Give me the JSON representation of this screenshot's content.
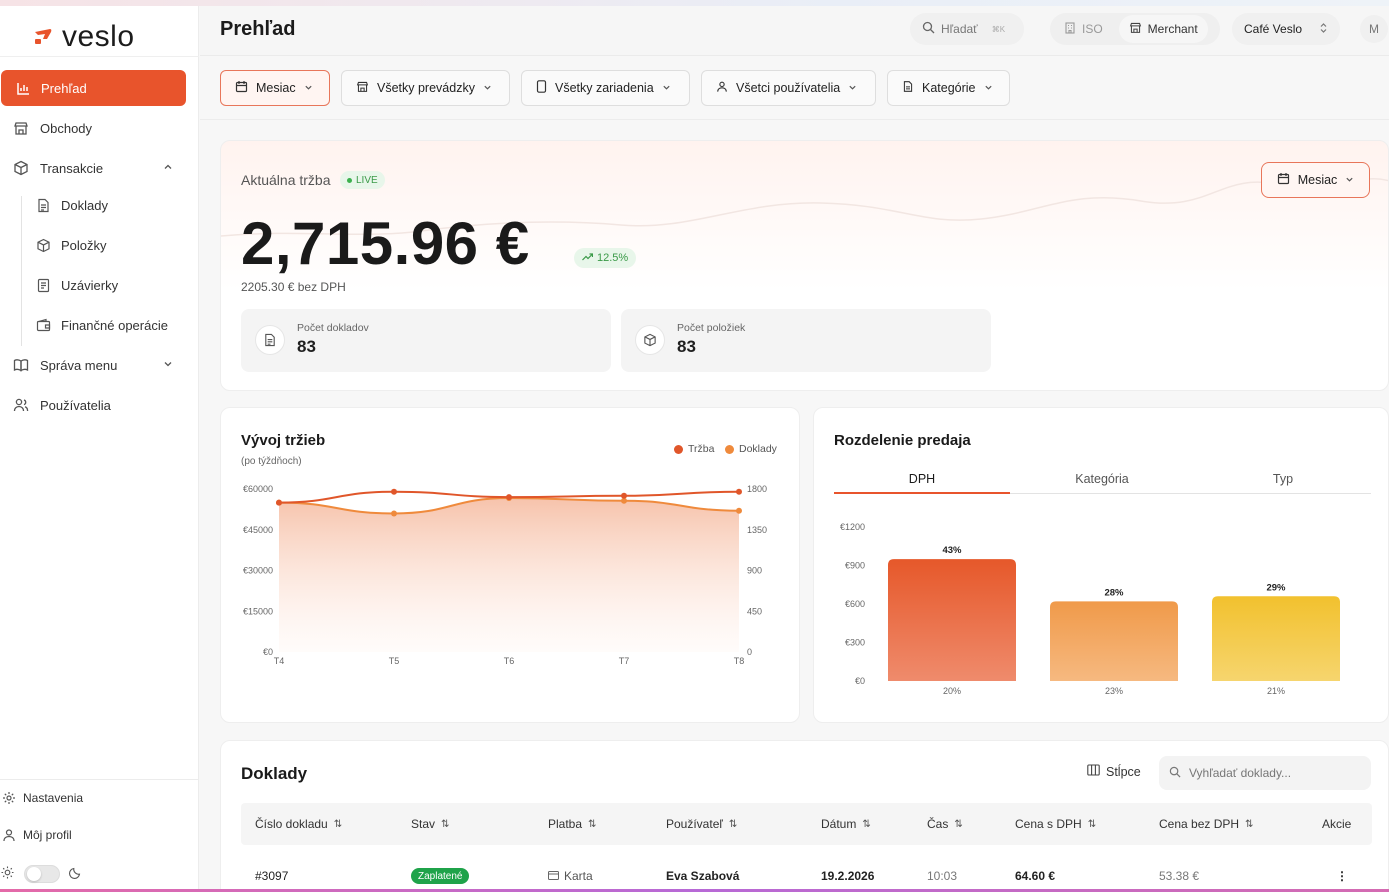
{
  "app": {
    "logo_text": "veslo",
    "brand_color": "#e8542c"
  },
  "sidebar": {
    "items": [
      {
        "label": "Prehľad",
        "icon": "bar-chart-icon",
        "active": true
      },
      {
        "label": "Obchody",
        "icon": "store-icon"
      },
      {
        "label": "Transakcie",
        "icon": "box-icon",
        "expanded": true
      },
      {
        "label": "Doklady",
        "icon": "document-icon",
        "sub": true
      },
      {
        "label": "Položky",
        "icon": "package-icon",
        "sub": true
      },
      {
        "label": "Uzávierky",
        "icon": "receipt-icon",
        "sub": true
      },
      {
        "label": "Finančné operácie",
        "icon": "wallet-icon",
        "sub": true
      },
      {
        "label": "Správa menu",
        "icon": "book-icon"
      },
      {
        "label": "Používatelia",
        "icon": "users-icon"
      }
    ],
    "bottom": {
      "settings": "Nastavenia",
      "profile": "Môj profil"
    }
  },
  "header": {
    "title": "Prehľad",
    "search_label": "Hľadať",
    "search_shortcut": "⌘K",
    "iso_label": "ISO",
    "merchant_label": "Merchant",
    "store_select": "Café Veslo",
    "avatar_initial": "M"
  },
  "filters": [
    {
      "label": "Mesiac",
      "icon": "calendar-icon",
      "active": true
    },
    {
      "label": "Všetky prevádzky",
      "icon": "store-icon"
    },
    {
      "label": "Všetky zariadenia",
      "icon": "device-icon"
    },
    {
      "label": "Všetci používatelia",
      "icon": "user-icon"
    },
    {
      "label": "Kategórie",
      "icon": "file-icon"
    }
  ],
  "revenue": {
    "label": "Aktuálna tržba",
    "live": "LIVE",
    "amount": "2,715.96 €",
    "trend": "12.5%",
    "without_vat": "2205.30 € bez DPH",
    "period_button": "Mesiac",
    "stats": [
      {
        "label": "Počet dokladov",
        "value": "83",
        "icon": "document-icon"
      },
      {
        "label": "Počet položiek",
        "value": "83",
        "icon": "package-icon"
      }
    ]
  },
  "trend_card": {
    "title": "Vývoj tržieb",
    "subtitle": "(po týždňoch)",
    "legend": [
      "Tržba",
      "Doklady"
    ]
  },
  "split_card": {
    "title": "Rozdelenie predaja",
    "tabs": [
      "DPH",
      "Kategória",
      "Typ"
    ],
    "active_tab": 0
  },
  "chart_data": [
    {
      "type": "line",
      "title": "Vývoj tržieb",
      "subtitle": "(po týždňoch)",
      "x": [
        "T4",
        "T5",
        "T6",
        "T7",
        "T8"
      ],
      "series": [
        {
          "name": "Tržba",
          "axis": "left",
          "values": [
            55000,
            59000,
            57000,
            57500,
            59000
          ],
          "color": "#e0562a"
        },
        {
          "name": "Doklady",
          "axis": "right",
          "values": [
            1650,
            1530,
            1700,
            1670,
            1560
          ],
          "color": "#ef8a3c"
        }
      ],
      "y_left": {
        "ticks": [
          "€0",
          "€15000",
          "€30000",
          "€45000",
          "€60000"
        ],
        "range": [
          0,
          60000
        ]
      },
      "y_right": {
        "ticks": [
          "0",
          "450",
          "900",
          "1350",
          "1800"
        ],
        "range": [
          0,
          1800
        ]
      },
      "grid": false,
      "legend_position": "top-right"
    },
    {
      "type": "bar",
      "title": "Rozdelenie predaja",
      "categories": [
        "20%",
        "23%",
        "21%"
      ],
      "values": [
        950,
        620,
        660
      ],
      "data_labels": [
        "43%",
        "28%",
        "29%"
      ],
      "colors": [
        [
          "#e6582a",
          "#ef8b6c"
        ],
        [
          "#f09a4a",
          "#f6b980"
        ],
        [
          "#f2c12e",
          "#f6d56e"
        ]
      ],
      "y_ticks": [
        "€0",
        "€300",
        "€600",
        "€900",
        "€1200"
      ],
      "ylim": [
        0,
        1200
      ]
    }
  ],
  "table": {
    "title": "Doklady",
    "columns_button": "Stĺpce",
    "search_placeholder": "Vyhľadať doklady...",
    "headers": [
      "Číslo dokladu",
      "Stav",
      "Platba",
      "Používateľ",
      "Dátum",
      "Čas",
      "Cena s DPH",
      "Cena bez DPH",
      "Akcie"
    ],
    "rows": [
      {
        "id": "#3097",
        "status": "Zaplatené",
        "payment": "Karta",
        "user": "Eva Szabová",
        "date": "19.2.2026",
        "time": "10:03",
        "price_vat": "64.60 €",
        "price_no_vat": "53.38 €"
      }
    ]
  }
}
